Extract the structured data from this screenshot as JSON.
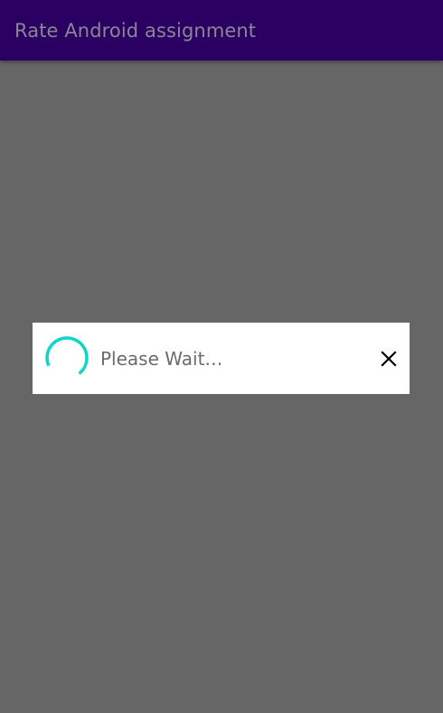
{
  "app_bar": {
    "title": "Rate Android assignment",
    "background_color": "#2b0063"
  },
  "dialog": {
    "message": "Please Wait…",
    "spinner_color": "#12d4c7",
    "close_icon": "close-icon"
  },
  "colors": {
    "scrim": "#666666",
    "dialog_background": "#ffffff"
  }
}
